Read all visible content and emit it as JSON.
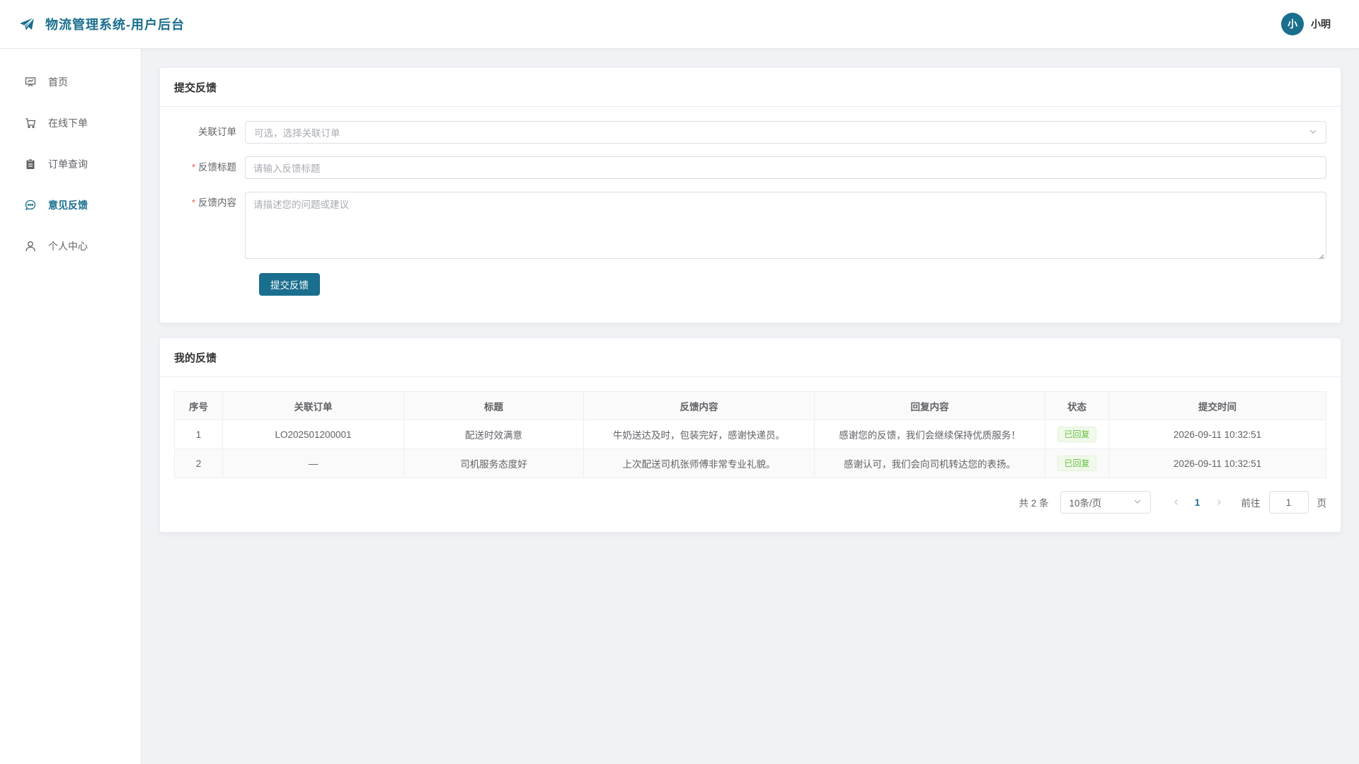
{
  "header": {
    "app_title": "物流管理系统-用户后台",
    "avatar_text": "小",
    "username": "小明"
  },
  "sidebar": {
    "items": [
      {
        "label": "首页",
        "icon": "presentation-icon"
      },
      {
        "label": "在线下单",
        "icon": "cart-icon"
      },
      {
        "label": "订单查询",
        "icon": "clipboard-icon"
      },
      {
        "label": "意见反馈",
        "icon": "chat-bubble-icon",
        "active": true
      },
      {
        "label": "个人中心",
        "icon": "user-icon"
      }
    ]
  },
  "submit_card": {
    "title": "提交反馈",
    "order_label": "关联订单",
    "order_placeholder": "可选，选择关联订单",
    "title_label": "反馈标题",
    "title_placeholder": "请输入反馈标题",
    "content_label": "反馈内容",
    "content_placeholder": "请描述您的问题或建议",
    "submit_label": "提交反馈"
  },
  "list_card": {
    "title": "我的反馈",
    "columns": [
      "序号",
      "关联订单",
      "标题",
      "反馈内容",
      "回复内容",
      "状态",
      "提交时间"
    ],
    "rows": [
      {
        "index": "1",
        "order": "LO202501200001",
        "title": "配送时效满意",
        "content": "牛奶送达及时，包装完好，感谢快递员。",
        "reply": "感谢您的反馈，我们会继续保持优质服务！",
        "status": "已回复",
        "time": "2026-09-11 10:32:51"
      },
      {
        "index": "2",
        "order": "—",
        "title": "司机服务态度好",
        "content": "上次配送司机张师傅非常专业礼貌。",
        "reply": "感谢认可，我们会向司机转达您的表扬。",
        "status": "已回复",
        "time": "2026-09-11 10:32:51"
      }
    ]
  },
  "pagination": {
    "total_text": "共 2 条",
    "page_size": "10条/页",
    "current_page": "1",
    "goto_label": "前往",
    "goto_value": "1",
    "page_suffix": "页"
  },
  "colors": {
    "primary": "#1a6e8e",
    "success": "#67c23a"
  }
}
